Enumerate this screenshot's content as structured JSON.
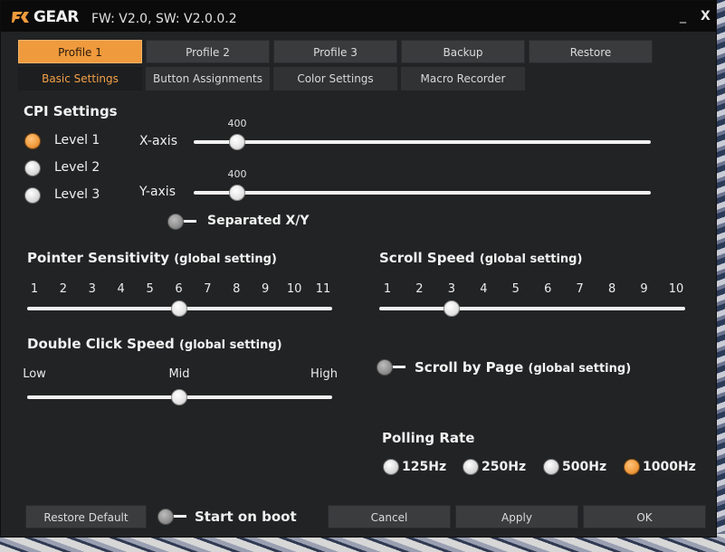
{
  "window": {
    "logo_text": "GEAR",
    "version": "FW: V2.0, SW: V2.0.0.2",
    "minimize": "_",
    "close": "X"
  },
  "profiles": {
    "tabs": [
      {
        "label": "Profile 1",
        "active": true
      },
      {
        "label": "Profile 2",
        "active": false
      },
      {
        "label": "Profile 3",
        "active": false
      },
      {
        "label": "Backup",
        "active": false
      },
      {
        "label": "Restore",
        "active": false
      }
    ]
  },
  "subtabs": [
    {
      "label": "Basic Settings",
      "active": true
    },
    {
      "label": "Button Assignments",
      "active": false
    },
    {
      "label": "Color Settings",
      "active": false
    },
    {
      "label": "Macro Recorder",
      "active": false
    }
  ],
  "cpi": {
    "title": "CPI Settings",
    "levels": [
      {
        "label": "Level 1",
        "selected": true
      },
      {
        "label": "Level 2",
        "selected": false
      },
      {
        "label": "Level 3",
        "selected": false
      }
    ],
    "x_axis": {
      "label": "X-axis",
      "value": "400",
      "fraction": 0.08
    },
    "y_axis": {
      "label": "Y-axis",
      "value": "400",
      "fraction": 0.08
    },
    "separated_label": "Separated X/Y",
    "separated_on": false
  },
  "pointer": {
    "title": "Pointer Sensitivity",
    "note": "(global setting)",
    "ticks": [
      "1",
      "2",
      "3",
      "4",
      "5",
      "6",
      "7",
      "8",
      "9",
      "10",
      "11"
    ],
    "value": 6
  },
  "double_click": {
    "title": "Double Click Speed",
    "note": "(global setting)",
    "ticks": [
      "Low",
      "Mid",
      "High"
    ],
    "value": "Mid"
  },
  "scroll": {
    "title": "Scroll Speed",
    "note": "(global setting)",
    "ticks": [
      "1",
      "2",
      "3",
      "4",
      "5",
      "6",
      "7",
      "8",
      "9",
      "10"
    ],
    "value": 3
  },
  "scroll_by_page": {
    "label": "Scroll by Page",
    "note": "(global setting)",
    "on": false
  },
  "polling": {
    "title": "Polling Rate",
    "options": [
      {
        "label": "125Hz",
        "selected": false
      },
      {
        "label": "250Hz",
        "selected": false
      },
      {
        "label": "500Hz",
        "selected": false
      },
      {
        "label": "1000Hz",
        "selected": true
      }
    ]
  },
  "footer": {
    "restore_default": "Restore Default",
    "start_on_boot": "Start on boot",
    "start_on_boot_on": false,
    "cancel": "Cancel",
    "apply": "Apply",
    "ok": "OK"
  },
  "colors": {
    "accent": "#ef9a3d",
    "background": "#222324",
    "titlebar": "#0b0b0b"
  }
}
